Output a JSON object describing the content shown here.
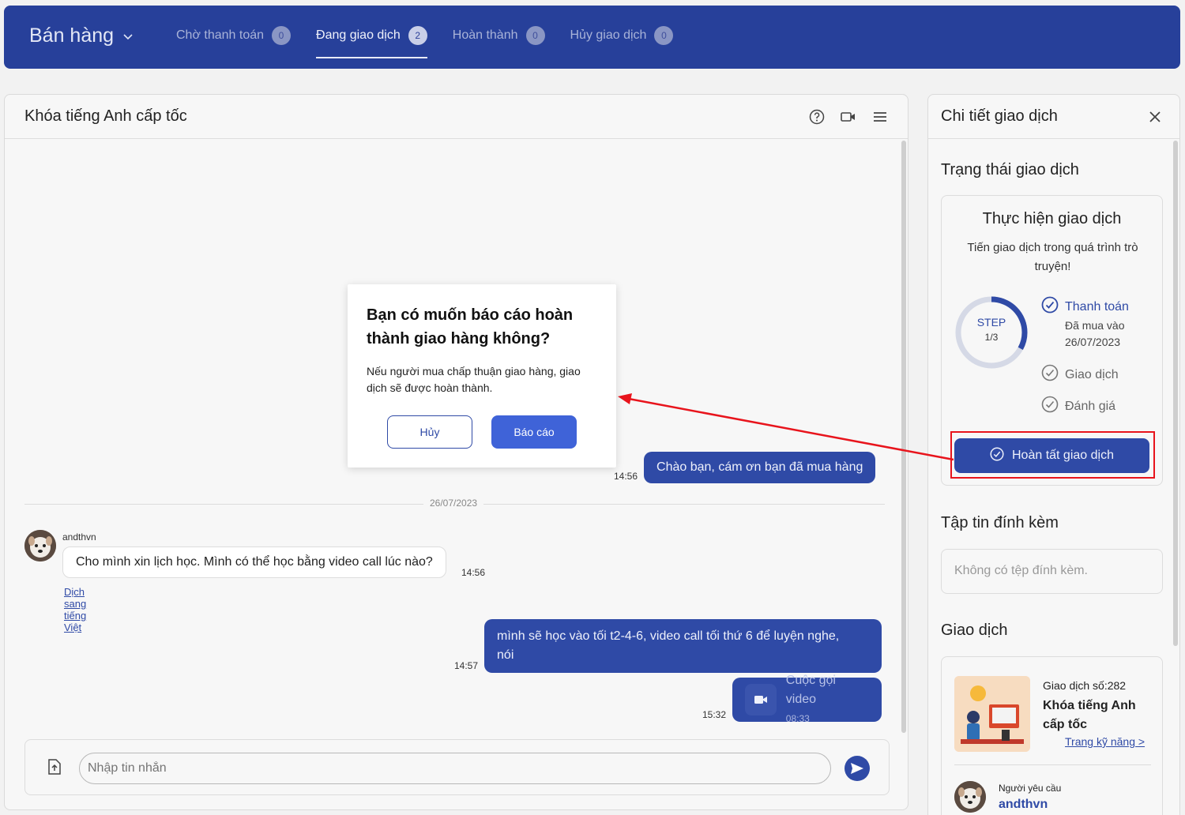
{
  "header": {
    "app_title": "Bán hàng",
    "tabs": [
      {
        "label": "Chờ thanh toán",
        "count": "0"
      },
      {
        "label": "Đang giao dịch",
        "count": "2"
      },
      {
        "label": "Hoàn thành",
        "count": "0"
      },
      {
        "label": "Hủy giao dịch",
        "count": "0"
      }
    ],
    "active_tab": "Đang giao dịch"
  },
  "chat": {
    "title": "Khóa tiếng Anh cấp tốc",
    "messages": {
      "first_out": {
        "text": "Chào bạn, cám ơn bạn đã mua hàng",
        "time": "14:56"
      },
      "date_divider": "26/07/2023",
      "incoming": {
        "sender": "andthvn",
        "text": "Cho mình xin lịch học. Mình có thể học bằng video call lúc nào?",
        "time": "14:56",
        "translate_link": "Dịch sang tiếng Việt"
      },
      "second_out": {
        "line1": "mình sẽ học vào tối t2-4-6, video call tối thứ 6 để luyện nghe,",
        "line2": "nói",
        "time": "14:57"
      },
      "video_call": {
        "title": "Cuộc gọi video",
        "duration": "08:33",
        "time": "15:32"
      }
    },
    "composer": {
      "placeholder": "Nhập tin nhắn"
    }
  },
  "details": {
    "title": "Chi tiết giao dịch",
    "status_section": "Trạng thái giao dịch",
    "status_card": {
      "heading": "Thực hiện giao dịch",
      "description": "Tiến giao dịch trong quá trình trò truyện!",
      "step_label": "STEP",
      "step_fraction": "1/3",
      "progress": 0.33,
      "steps": [
        {
          "label": "Thanh toán",
          "sub1": "Đã mua vào",
          "sub2": "26/07/2023",
          "done": true
        },
        {
          "label": "Giao dịch",
          "done": false
        },
        {
          "label": "Đánh giá",
          "done": false
        }
      ],
      "complete_button": "Hoàn tất giao dịch"
    },
    "attachments_section": "Tập tin đính kèm",
    "attachments_empty": "Không có tệp đính kèm.",
    "transaction_section": "Giao dịch",
    "transaction": {
      "number": "Giao dịch số:282",
      "name": "Khóa tiếng Anh cấp tốc",
      "link": "Trang kỹ năng >",
      "requester_label": "Người yêu cầu",
      "requester_name": "andthvn"
    }
  },
  "modal": {
    "title": "Bạn có muốn báo cáo hoàn thành giao hàng không?",
    "body": "Nếu người mua chấp thuận giao hàng, giao dịch sẽ được hoàn thành.",
    "cancel": "Hủy",
    "confirm": "Báo cáo"
  },
  "colors": {
    "primary": "#2f4aa6",
    "header_bg": "#27409a",
    "confirm_button": "#3f63d8",
    "annotation_red": "#e8141c"
  }
}
